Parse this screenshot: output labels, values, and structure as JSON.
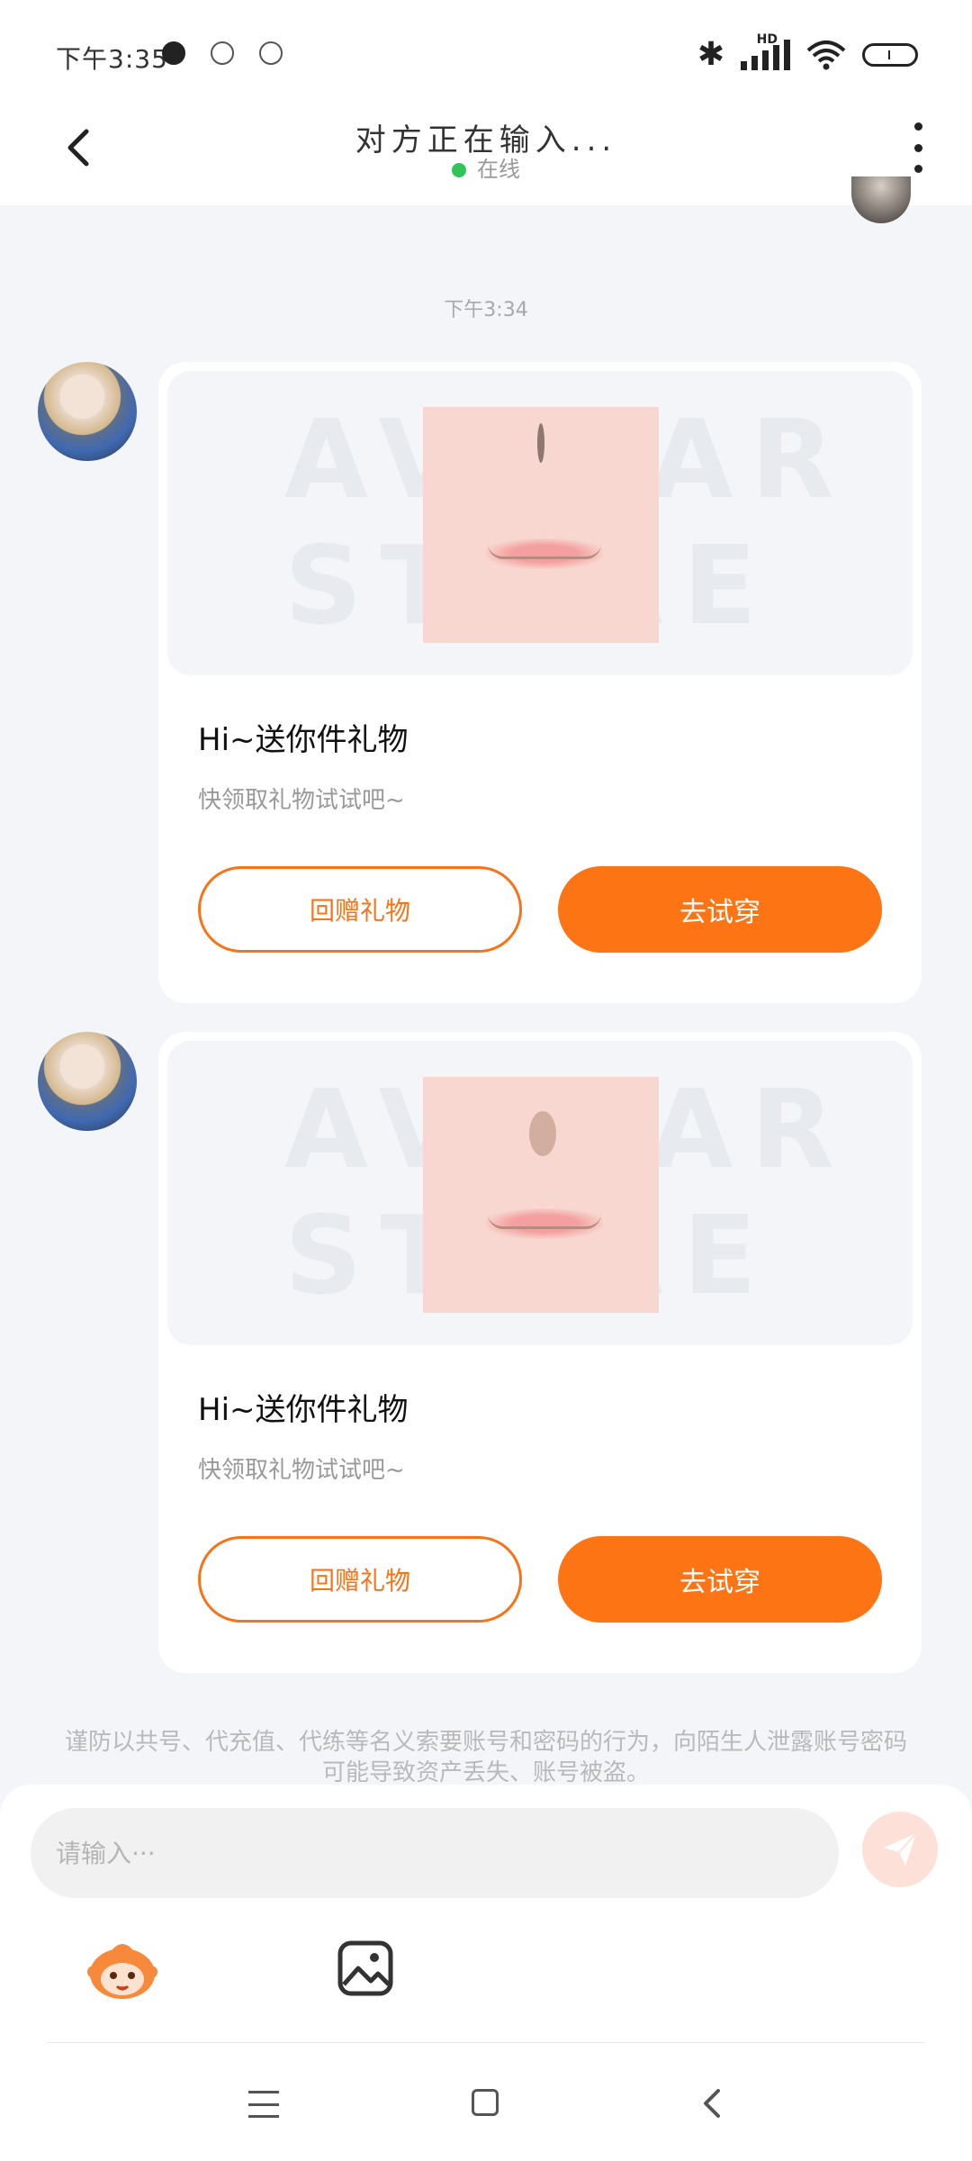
{
  "status_bar": {
    "time": "下午3:35",
    "network": "HD",
    "icons": [
      "cloud-app-icon",
      "shield-icon",
      "chat-bubble-icon",
      "bluetooth-icon",
      "signal-icon",
      "wifi-icon",
      "battery-icon"
    ]
  },
  "header": {
    "title": "对方正在输入...",
    "status": "在线",
    "status_color": "#2fc55a"
  },
  "timestamp": "下午3:34",
  "messages": [
    {
      "watermark": "AVATAR STORE",
      "gift_title": "Hi~送你件礼物",
      "gift_subtitle": "快领取礼物试试吧~",
      "return_button": "回赠礼物",
      "try_button": "去试穿"
    },
    {
      "watermark": "AVATAR STORE",
      "gift_title": "Hi~送你件礼物",
      "gift_subtitle": "快领取礼物试试吧~",
      "return_button": "回赠礼物",
      "try_button": "去试穿"
    }
  ],
  "warning": "谨防以共号、代充值、代练等名义索要账号和密码的行为，向陌生人泄露账号密码可能导致资产丢失、账号被盗。",
  "input": {
    "placeholder": "请输入···",
    "value": ""
  },
  "colors": {
    "accent": "#fd7414",
    "background": "#f3f5f8"
  }
}
